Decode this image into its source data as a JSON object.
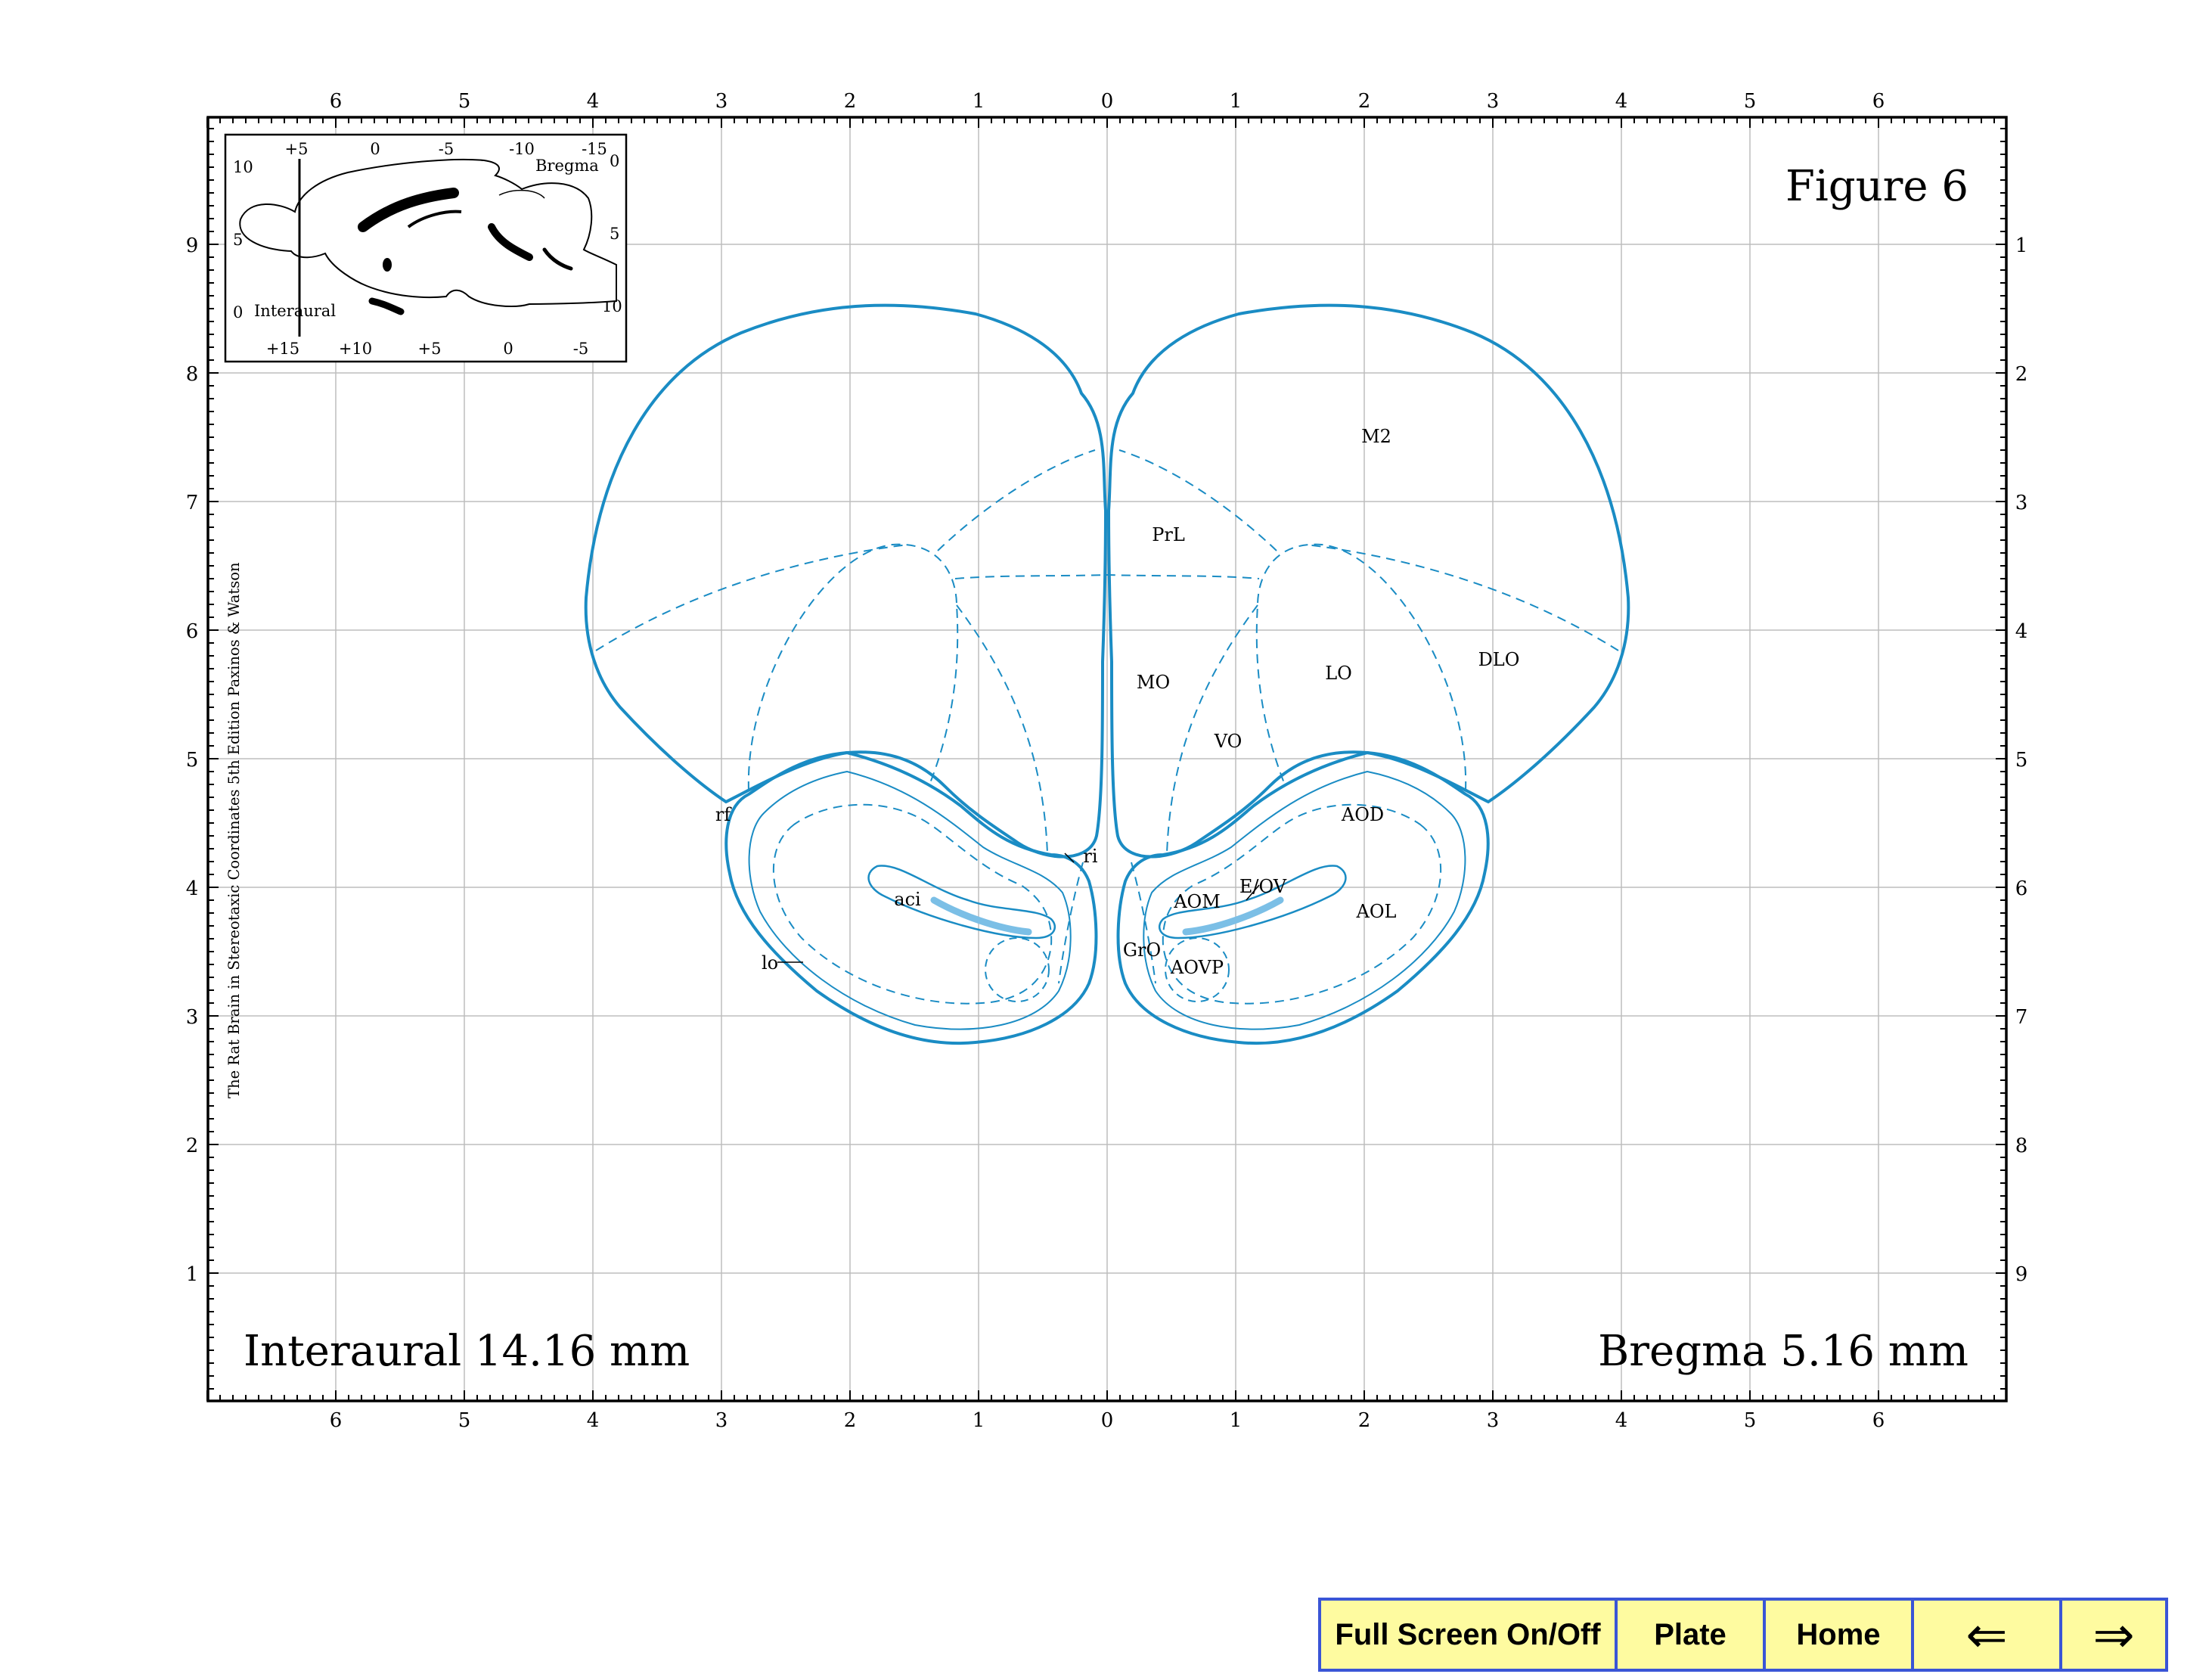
{
  "figure_title": "Figure 6",
  "interaural_label": "Interaural 14.16 mm",
  "bregma_label": "Bregma 5.16 mm",
  "side_credit": "The Rat Brain in Stereotaxic Coordinates  5th Edition  Paxinos & Watson",
  "top_scale": [
    "6",
    "5",
    "4",
    "3",
    "2",
    "1",
    "0",
    "1",
    "2",
    "3",
    "4",
    "5",
    "6"
  ],
  "bottom_scale": [
    "6",
    "5",
    "4",
    "3",
    "2",
    "1",
    "0",
    "1",
    "2",
    "3",
    "4",
    "5",
    "6"
  ],
  "left_scale": [
    "9",
    "8",
    "7",
    "6",
    "5",
    "4",
    "3",
    "2",
    "1"
  ],
  "right_scale": [
    "1",
    "2",
    "3",
    "4",
    "5",
    "6",
    "7",
    "8",
    "9"
  ],
  "inset": {
    "top_ticks": [
      "+5",
      "0",
      "-5",
      "-10",
      "-15"
    ],
    "bottom_ticks": [
      "+15",
      "+10",
      "+5",
      "0",
      "-5"
    ],
    "left_ticks": [
      "10",
      "5",
      "0"
    ],
    "right_ticks": [
      "0",
      "5",
      "10"
    ],
    "bregma_label": "Bregma",
    "interaural_label": "Interaural"
  },
  "regions": {
    "m2": "M2",
    "prl": "PrL",
    "mo": "MO",
    "vo": "VO",
    "lo": "LO",
    "dlo": "DLO",
    "aod": "AOD",
    "aom": "AOM",
    "eov": "E/OV",
    "aol": "AOL",
    "aovp": "AOVP",
    "gro": "GrO",
    "aci": "aci",
    "lo_tract": "lo",
    "rf": "rf",
    "ri": "ri"
  },
  "colors": {
    "atlas_blue": "#1a8cc4",
    "tract_fill": "#7bbfe6",
    "grid": "#bdbdbd",
    "nav_bg": "#fefba0",
    "nav_border": "#3a55d6"
  },
  "nav": {
    "fullscreen": "Full Screen On/Off",
    "plate": "Plate",
    "home": "Home",
    "prev": "⇐",
    "next": "⇒"
  }
}
